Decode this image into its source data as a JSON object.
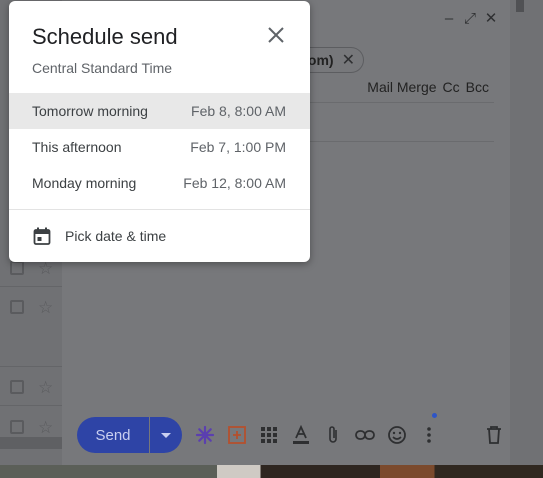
{
  "popup": {
    "title": "Schedule send",
    "timezone": "Central Standard Time",
    "options": [
      {
        "label": "Tomorrow morning",
        "when": "Feb 8, 8:00 AM",
        "selected": true
      },
      {
        "label": "This afternoon",
        "when": "Feb 7, 1:00 PM",
        "selected": false
      },
      {
        "label": "Monday morning",
        "when": "Feb 12, 8:00 AM",
        "selected": false
      }
    ],
    "pick_label": "Pick date & time"
  },
  "compose": {
    "recipient_chip_tail": "om)",
    "mail_merge": "Mail Merge",
    "cc": "Cc",
    "bcc": "Bcc",
    "send_label": "Send"
  },
  "colors": {
    "send_button": "#2e44a6",
    "selected_option_bg": "#e8e8e8",
    "popup_bg": "#ffffff"
  },
  "icons": [
    "close-icon",
    "calendar-icon",
    "minimize-icon",
    "expand-icon",
    "send-options-icon",
    "star-burst-icon",
    "add-box-icon",
    "grid-icon",
    "text-format-icon",
    "attach-icon",
    "link-icon",
    "emoji-icon",
    "more-icon",
    "trash-icon",
    "checkbox-icon",
    "star-icon"
  ]
}
